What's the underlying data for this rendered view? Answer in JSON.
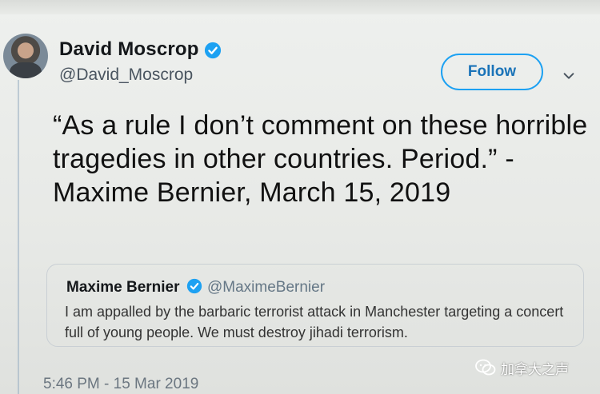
{
  "tweet": {
    "author_name": "David Moscrop",
    "author_handle": "@David_Moscrop",
    "follow_label": "Follow",
    "text": "“As a rule I don’t comment on these horrible tragedies in other countries. Period.” - Maxime Bernier, March 15, 2019",
    "timestamp": "5:46 PM - 15 Mar 2019"
  },
  "quoted_tweet": {
    "author_name": "Maxime Bernier",
    "author_handle": "@MaximeBernier",
    "text": "I am appalled by the barbaric terrorist attack in Manchester targeting a concert full of young people. We must destroy jihadi terrorism."
  },
  "watermark": {
    "text": "加拿大之声",
    "icon": "wechat-icon"
  },
  "icons": {
    "verified": "verified-badge-icon",
    "more": "chevron-down-icon",
    "avatar": "avatar"
  },
  "colors": {
    "accent": "#1da1f2",
    "follow_text": "#1a73b8"
  }
}
